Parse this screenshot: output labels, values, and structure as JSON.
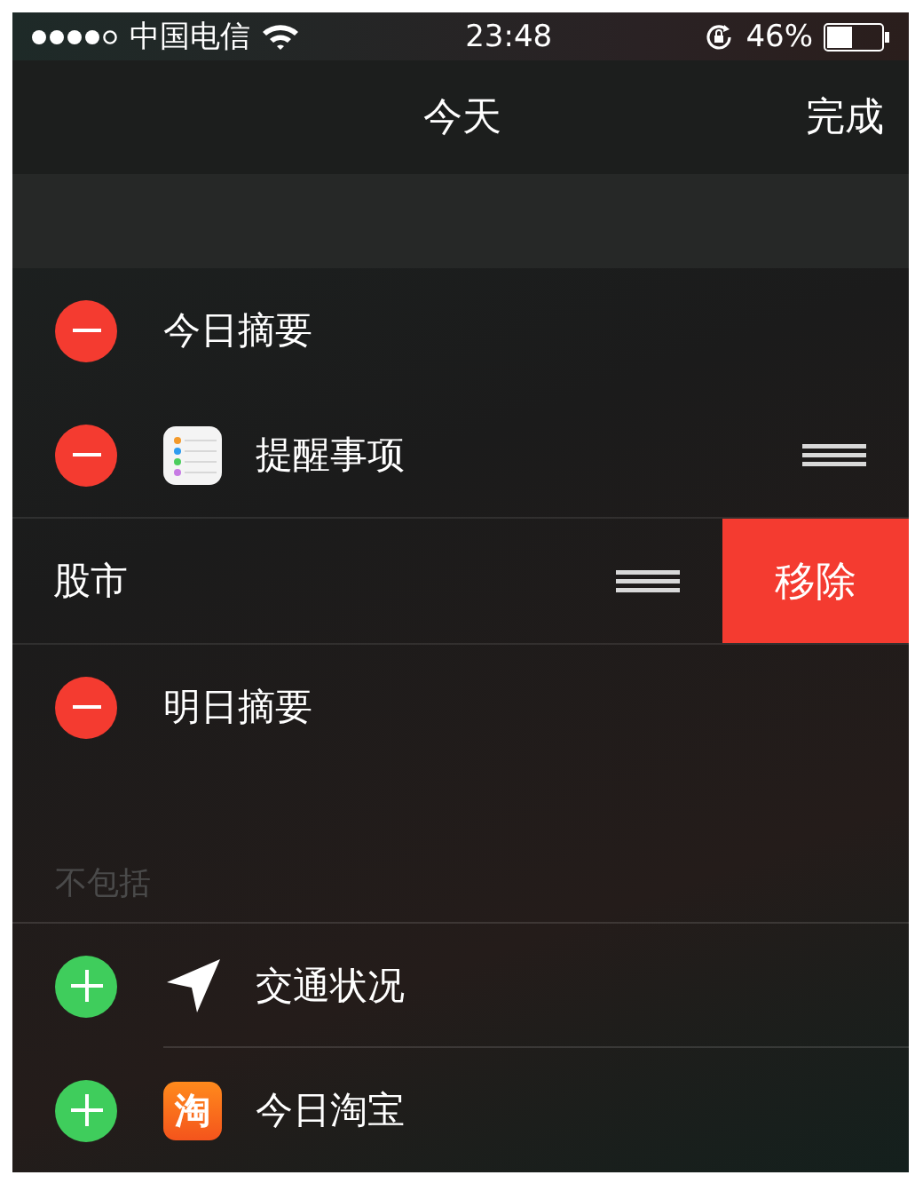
{
  "status_bar": {
    "carrier": "中国电信",
    "time": "23:48",
    "battery": "46%"
  },
  "nav": {
    "title": "今天",
    "done": "完成"
  },
  "included": [
    {
      "label": "今日摘要",
      "kind": "plain",
      "reorderable": false,
      "swiped": false
    },
    {
      "label": "提醒事项",
      "kind": "reminders",
      "reorderable": true,
      "swiped": false
    },
    {
      "label": "股市",
      "kind": "plain",
      "reorderable": true,
      "swiped": true,
      "remove": "移除"
    },
    {
      "label": "明日摘要",
      "kind": "plain",
      "reorderable": false,
      "swiped": false
    }
  ],
  "excluded_header": "不包括",
  "excluded": [
    {
      "label": "交通状况",
      "kind": "location"
    },
    {
      "label": "今日淘宝",
      "kind": "shopping",
      "icon_text": "淘"
    }
  ]
}
